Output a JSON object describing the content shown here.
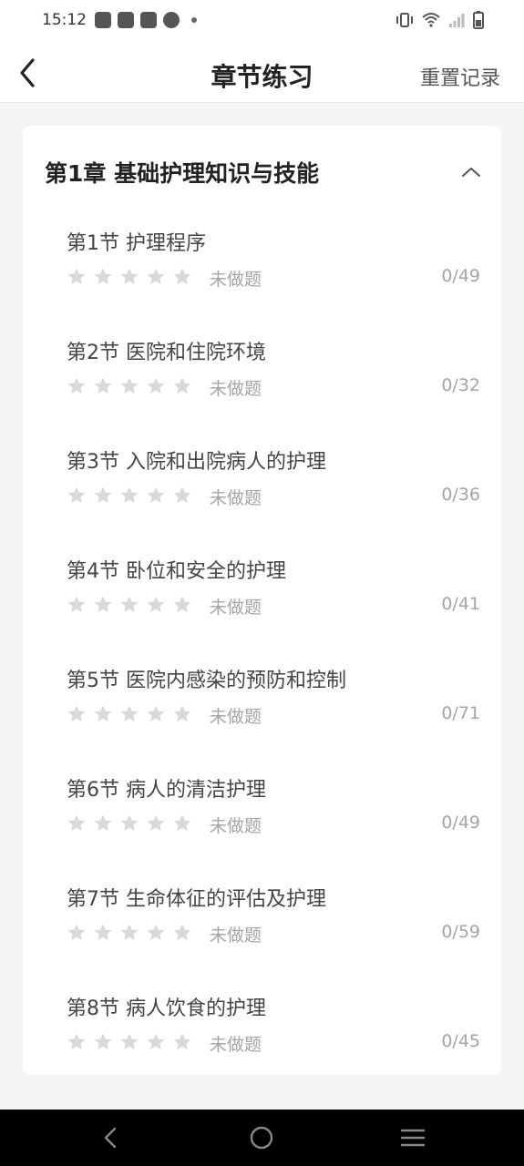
{
  "status_bar": {
    "time": "15:12",
    "left_icons": [
      "shopping-bag-icon",
      "shopping-bag-icon",
      "shopping-bag-icon",
      "gauge-icon",
      "dot-icon"
    ],
    "right_icons": [
      "vibrate-icon",
      "wifi-icon",
      "signal-icon",
      "battery-icon"
    ]
  },
  "header": {
    "title": "章节练习",
    "reset_label": "重置记录",
    "back_icon": "chevron-left-icon"
  },
  "chapter": {
    "title": "第1章 基础护理知识与技能",
    "expanded": true,
    "sections": [
      {
        "title": "第1节 护理程序",
        "stars_filled": 0,
        "stars_total": 5,
        "status": "未做题",
        "count": "0/49"
      },
      {
        "title": "第2节 医院和住院环境",
        "stars_filled": 0,
        "stars_total": 5,
        "status": "未做题",
        "count": "0/32"
      },
      {
        "title": "第3节 入院和出院病人的护理",
        "stars_filled": 0,
        "stars_total": 5,
        "status": "未做题",
        "count": "0/36"
      },
      {
        "title": "第4节 卧位和安全的护理",
        "stars_filled": 0,
        "stars_total": 5,
        "status": "未做题",
        "count": "0/41"
      },
      {
        "title": "第5节 医院内感染的预防和控制",
        "stars_filled": 0,
        "stars_total": 5,
        "status": "未做题",
        "count": "0/71"
      },
      {
        "title": "第6节 病人的清洁护理",
        "stars_filled": 0,
        "stars_total": 5,
        "status": "未做题",
        "count": "0/49"
      },
      {
        "title": "第7节 生命体征的评估及护理",
        "stars_filled": 0,
        "stars_total": 5,
        "status": "未做题",
        "count": "0/59"
      },
      {
        "title": "第8节 病人饮食的护理",
        "stars_filled": 0,
        "stars_total": 5,
        "status": "未做题",
        "count": "0/45"
      }
    ]
  },
  "nav_bar": {
    "icons": [
      "back-triangle-icon",
      "home-circle-icon",
      "menu-lines-icon"
    ]
  },
  "colors": {
    "accent_text": "#222222",
    "muted_text": "#a5a5a5",
    "star_empty": "#d9d9d9",
    "background": "#f5f5f5"
  }
}
